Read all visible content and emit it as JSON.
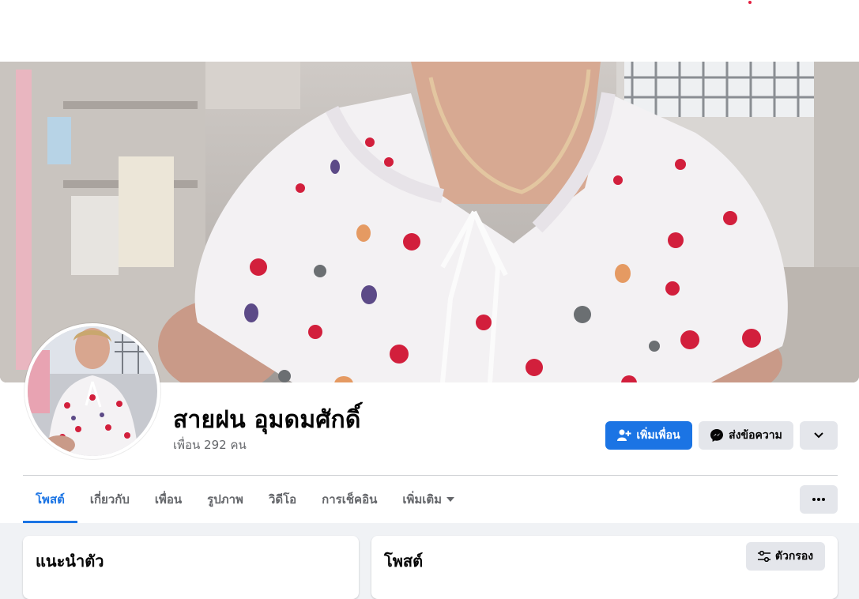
{
  "colors": {
    "brand_blue": "#1b74e4",
    "secondary_button": "#e4e6eb",
    "page_background": "#f0f2f5",
    "muted_text": "#65676b",
    "notification_dot": "#e41e3f"
  },
  "profile": {
    "name": "สายฝน อุมดมศักดิ์",
    "friends_count": "เพื่อน 292 คน"
  },
  "actions": {
    "add_friend": "เพิ่มเพื่อน",
    "message": "ส่งข้อความ",
    "more_icon": "chevron-down-icon"
  },
  "tabs": [
    {
      "label": "โพสต์",
      "active": true
    },
    {
      "label": "เกี่ยวกับ",
      "active": false
    },
    {
      "label": "เพื่อน",
      "active": false
    },
    {
      "label": "รูปภาพ",
      "active": false
    },
    {
      "label": "วิดีโอ",
      "active": false
    },
    {
      "label": "การเช็คอิน",
      "active": false
    },
    {
      "label": "เพิ่มเติม",
      "active": false
    }
  ],
  "intro_panel": {
    "title": "แนะนำตัว"
  },
  "posts_panel": {
    "title": "โพสต์",
    "filter_label": "ตัวกรอง"
  }
}
